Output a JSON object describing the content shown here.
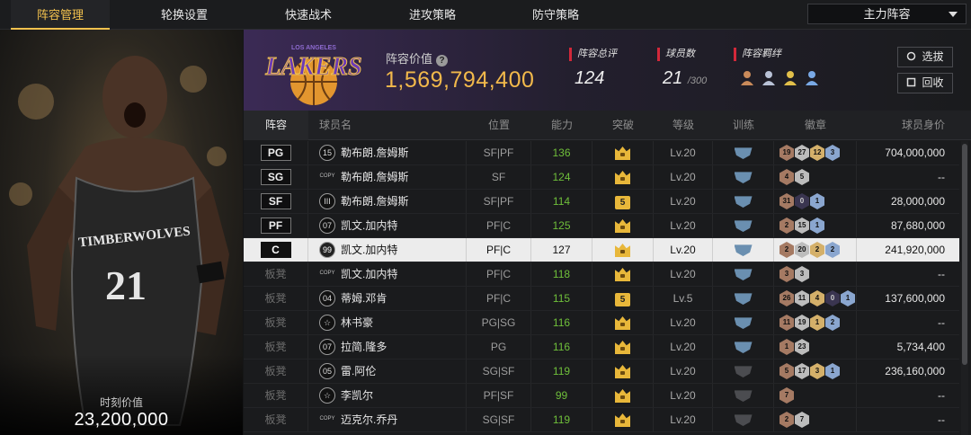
{
  "tabs": [
    {
      "label": "阵容管理",
      "active": true
    },
    {
      "label": "轮换设置",
      "active": false
    },
    {
      "label": "快速战术",
      "active": false
    },
    {
      "label": "进攻策略",
      "active": false
    },
    {
      "label": "防守策略",
      "active": false
    }
  ],
  "lineup_select": {
    "value": "主力阵容"
  },
  "player_card": {
    "value_label": "时刻价值",
    "value": "23,200,000",
    "jersey": "21",
    "team_text": "TIMBERWOLVES"
  },
  "team": {
    "logo_text": "LAKERS",
    "logo_subtext": "LOS ANGELES",
    "team_value_label": "阵容价值",
    "team_value": "1,569,794,400",
    "overall_label": "阵容总评",
    "overall_value": "124",
    "count_label": "球员数",
    "count_value": "21",
    "count_max": "/300",
    "bonds_label": "阵容羁绊",
    "bond_icons": [
      "bond-icon",
      "bond-icon",
      "bond-icon",
      "bond-icon"
    ]
  },
  "buttons": {
    "select": "选拔",
    "recycle": "回收"
  },
  "columns": [
    "阵容",
    "球员名",
    "位置",
    "能力",
    "突破",
    "等级",
    "训练",
    "徽章",
    "球员身价"
  ],
  "rows": [
    {
      "slot": "PG",
      "bench": false,
      "pi": "15",
      "name": "勒布朗.詹姆斯",
      "pos": "SF|PF",
      "ability": "136",
      "break": "crown",
      "level": "Lv.20",
      "train": true,
      "badges": [
        [
          "b",
          "19"
        ],
        [
          "s",
          "27"
        ],
        [
          "g",
          "12"
        ],
        [
          "p",
          "3"
        ]
      ],
      "price": "704,000,000"
    },
    {
      "slot": "SG",
      "bench": false,
      "pi": "COPY",
      "name": "勒布朗.詹姆斯",
      "pos": "SF",
      "ability": "124",
      "break": "crown",
      "level": "Lv.20",
      "train": true,
      "badges": [
        [
          "b",
          "4"
        ],
        [
          "s",
          "5"
        ]
      ],
      "price": "--"
    },
    {
      "slot": "SF",
      "bench": false,
      "pi": "III",
      "name": "勒布朗.詹姆斯",
      "pos": "SF|PF",
      "ability": "114",
      "break": "5",
      "level": "Lv.20",
      "train": true,
      "badges": [
        [
          "b",
          "31"
        ],
        [
          "d",
          "0"
        ],
        [
          "p",
          "1"
        ]
      ],
      "price": "28,000,000"
    },
    {
      "slot": "PF",
      "bench": false,
      "pi": "07",
      "name": "凯文.加内特",
      "pos": "PF|C",
      "ability": "125",
      "break": "crown",
      "level": "Lv.20",
      "train": true,
      "badges": [
        [
          "b",
          "2"
        ],
        [
          "s",
          "15"
        ],
        [
          "p",
          "1"
        ]
      ],
      "price": "87,680,000"
    },
    {
      "slot": "C",
      "bench": false,
      "sel": true,
      "pi": "99",
      "name": "凯文.加内特",
      "pos": "PF|C",
      "ability": "127",
      "break": "crown",
      "level": "Lv.20",
      "train": true,
      "badges": [
        [
          "b",
          "2"
        ],
        [
          "s",
          "20"
        ],
        [
          "g",
          "2"
        ],
        [
          "p",
          "2"
        ]
      ],
      "price": "241,920,000"
    },
    {
      "slot": "板凳",
      "bench": true,
      "pi": "COPY",
      "name": "凯文.加内特",
      "pos": "PF|C",
      "ability": "118",
      "break": "crown",
      "level": "Lv.20",
      "train": true,
      "badges": [
        [
          "b",
          "3"
        ],
        [
          "s",
          "3"
        ]
      ],
      "price": "--"
    },
    {
      "slot": "板凳",
      "bench": true,
      "pi": "04",
      "name": "蒂姆.邓肯",
      "pos": "PF|C",
      "ability": "115",
      "break": "5",
      "level": "Lv.5",
      "train": true,
      "badges": [
        [
          "b",
          "26"
        ],
        [
          "s",
          "11"
        ],
        [
          "g",
          "4"
        ],
        [
          "d",
          "0"
        ],
        [
          "p",
          "1"
        ]
      ],
      "price": "137,600,000"
    },
    {
      "slot": "板凳",
      "bench": true,
      "pi": "☆",
      "name": "林书豪",
      "pos": "PG|SG",
      "ability": "116",
      "break": "crown",
      "level": "Lv.20",
      "train": true,
      "badges": [
        [
          "b",
          "11"
        ],
        [
          "s",
          "19"
        ],
        [
          "g",
          "1"
        ],
        [
          "p",
          "2"
        ]
      ],
      "price": "--"
    },
    {
      "slot": "板凳",
      "bench": true,
      "pi": "07",
      "name": "拉简.隆多",
      "pos": "PG",
      "ability": "116",
      "break": "crown",
      "level": "Lv.20",
      "train": true,
      "badges": [
        [
          "b",
          "1"
        ],
        [
          "s",
          "23"
        ]
      ],
      "price": "5,734,400"
    },
    {
      "slot": "板凳",
      "bench": true,
      "pi": "05",
      "name": "雷.阿伦",
      "pos": "SG|SF",
      "ability": "119",
      "break": "crown",
      "level": "Lv.20",
      "train": false,
      "badges": [
        [
          "b",
          "5"
        ],
        [
          "s",
          "17"
        ],
        [
          "g",
          "3"
        ],
        [
          "p",
          "1"
        ]
      ],
      "price": "236,160,000"
    },
    {
      "slot": "板凳",
      "bench": true,
      "pi": "☆",
      "name": "李凯尔",
      "pos": "PF|SF",
      "ability": "99",
      "break": "crown",
      "level": "Lv.20",
      "train": false,
      "badges": [
        [
          "b",
          "7"
        ]
      ],
      "price": "--"
    },
    {
      "slot": "板凳",
      "bench": true,
      "pi": "COPY",
      "name": "迈克尔.乔丹",
      "pos": "SG|SF",
      "ability": "119",
      "break": "crown",
      "level": "Lv.20",
      "train": false,
      "badges": [
        [
          "b",
          "2"
        ],
        [
          "s",
          "7"
        ]
      ],
      "price": "--"
    }
  ]
}
